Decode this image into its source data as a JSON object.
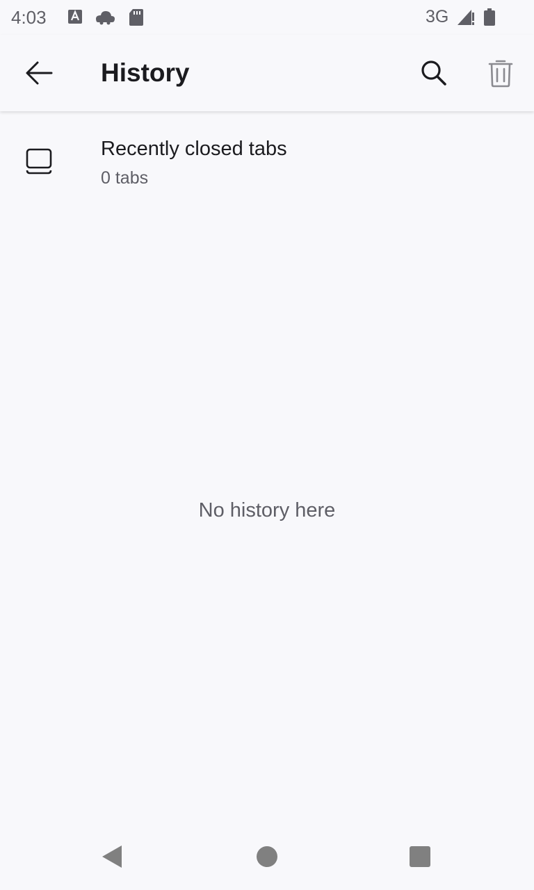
{
  "status_bar": {
    "time": "4:03",
    "network": "3G",
    "icons": [
      "a-notification-icon",
      "cloud-icon",
      "sd-card-icon",
      "signal-icon",
      "battery-icon"
    ],
    "color": "#5f5f66"
  },
  "toolbar": {
    "title": "History",
    "back_icon": "arrow-back-icon",
    "search_icon": "search-icon",
    "delete_icon": "trash-icon"
  },
  "recently_closed": {
    "title": "Recently closed tabs",
    "subtitle": "0 tabs",
    "icon": "tabs-icon"
  },
  "empty_message": "No history here",
  "nav_bar": {
    "icons": [
      "back-triangle-icon",
      "home-circle-icon",
      "recents-square-icon"
    ]
  },
  "colors": {
    "background": "#f8f8fb",
    "text_primary": "#1b1b1f",
    "text_secondary": "#5e5e66",
    "disabled_icon": "#8a8a90"
  }
}
